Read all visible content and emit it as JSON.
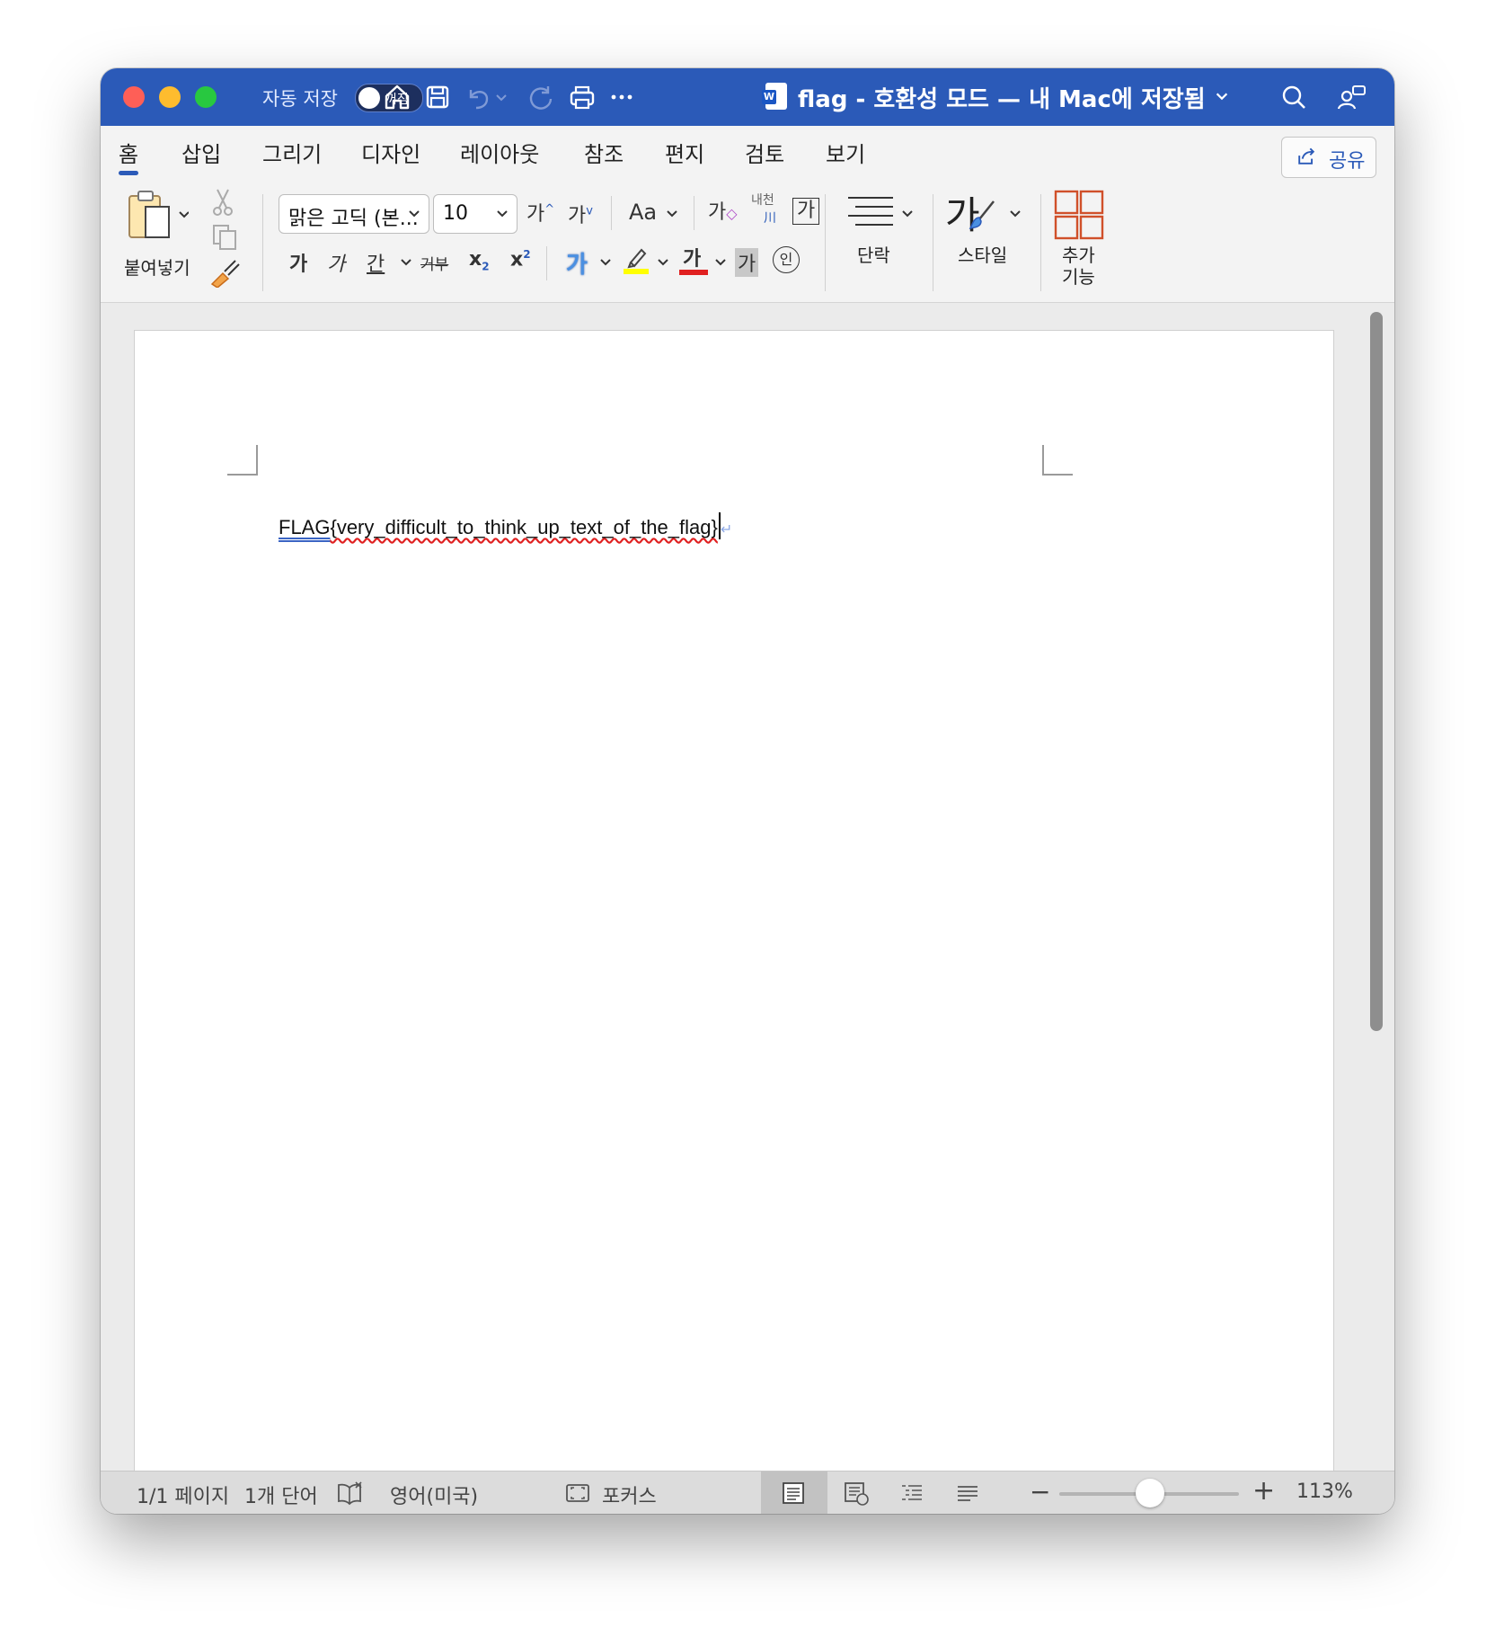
{
  "titlebar": {
    "autosave_label": "자동 저장",
    "autosave_toggle": "꺼짐",
    "doc_title": "flag  -  호환성 모드 — 내 Mac에 저장됨"
  },
  "tabs": [
    {
      "label": "홈"
    },
    {
      "label": "삽입"
    },
    {
      "label": "그리기"
    },
    {
      "label": "디자인"
    },
    {
      "label": "레이아웃"
    },
    {
      "label": "참조"
    },
    {
      "label": "편지"
    },
    {
      "label": "검토"
    },
    {
      "label": "보기"
    }
  ],
  "share_label": "공유",
  "ribbon": {
    "paste_label": "붙여넣기",
    "font_name": "맑은 고딕 (본...",
    "font_size": "10",
    "grow_font": "가",
    "shrink_font": "가",
    "change_case": "Aa",
    "clear_format": "가",
    "phonetic": "내천",
    "enclose_char": "가",
    "bold": "가",
    "italic": "가",
    "underline": "간",
    "strike": "거부",
    "subscript": "x",
    "superscript": "x",
    "text_effects": "가",
    "font_color": "가",
    "char_shading": "가",
    "enclose_circle": "인",
    "paragraph_label": "단락",
    "styles_glyph": "가",
    "styles_label": "스타일",
    "addins_label_line1": "추가",
    "addins_label_line2": "기능"
  },
  "document": {
    "text_grammar": "FLAG",
    "text_spell": "{very_difficult_to_think_up_text_of_the_flag}"
  },
  "statusbar": {
    "page_info": "1/1 페이지",
    "word_count": "1개 단어",
    "language": "영어(미국)",
    "focus_label": "포커스",
    "zoom": "113%"
  },
  "colors": {
    "titlebar": "#2b5ab8",
    "highlight": "#ffff00",
    "font_color": "#e02020"
  }
}
